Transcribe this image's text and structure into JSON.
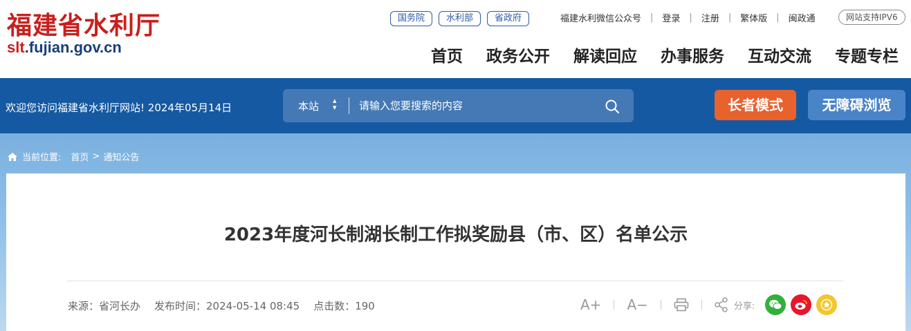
{
  "site": {
    "name": "福建省水利厅",
    "url_highlight": "slt",
    "url_rest": ".fujian.gov.cn"
  },
  "gov_links": [
    "国务院",
    "水利部",
    "省政府"
  ],
  "top_links": [
    "福建水利微信公众号",
    "登录",
    "注册",
    "繁体版",
    "闽政通"
  ],
  "ipv6_badge": "网站支持IPV6",
  "main_nav": [
    "首页",
    "政务公开",
    "解读回应",
    "办事服务",
    "互动交流",
    "专题专栏"
  ],
  "welcome_text": "欢迎您访问福建省水利厅网站! 2024年05月14日",
  "search": {
    "scope": "本站",
    "placeholder": "请输入您要搜索的内容"
  },
  "buttons": {
    "elder_mode": "长者模式",
    "accessibility": "无障碍浏览"
  },
  "breadcrumb": {
    "label": "当前位置:",
    "items": [
      "首页",
      "通知公告"
    ],
    "separator": ">"
  },
  "article": {
    "title": "2023年度河长制湖长制工作拟奖励县（市、区）名单公示",
    "source": "来源：省河长办",
    "publish_time": "发布时间：2024-05-14 08:45",
    "clicks": "点击数：190"
  },
  "tools": {
    "font_increase": "A+",
    "font_decrease": "A−",
    "share_label": "分享:"
  },
  "colors": {
    "brand_red": "#c8201d",
    "header_blue": "#1559a2",
    "elder_orange": "#e8622e",
    "access_blue": "#4a84c8",
    "wechat_green": "#2fb13a",
    "weibo_red": "#e6162d",
    "favorite_yellow": "#f2c72e"
  },
  "icons": [
    "home-icon",
    "search-icon",
    "print-icon",
    "share-icon",
    "wechat-icon",
    "weibo-icon",
    "favorite-icon",
    "sort-arrows-icon"
  ]
}
